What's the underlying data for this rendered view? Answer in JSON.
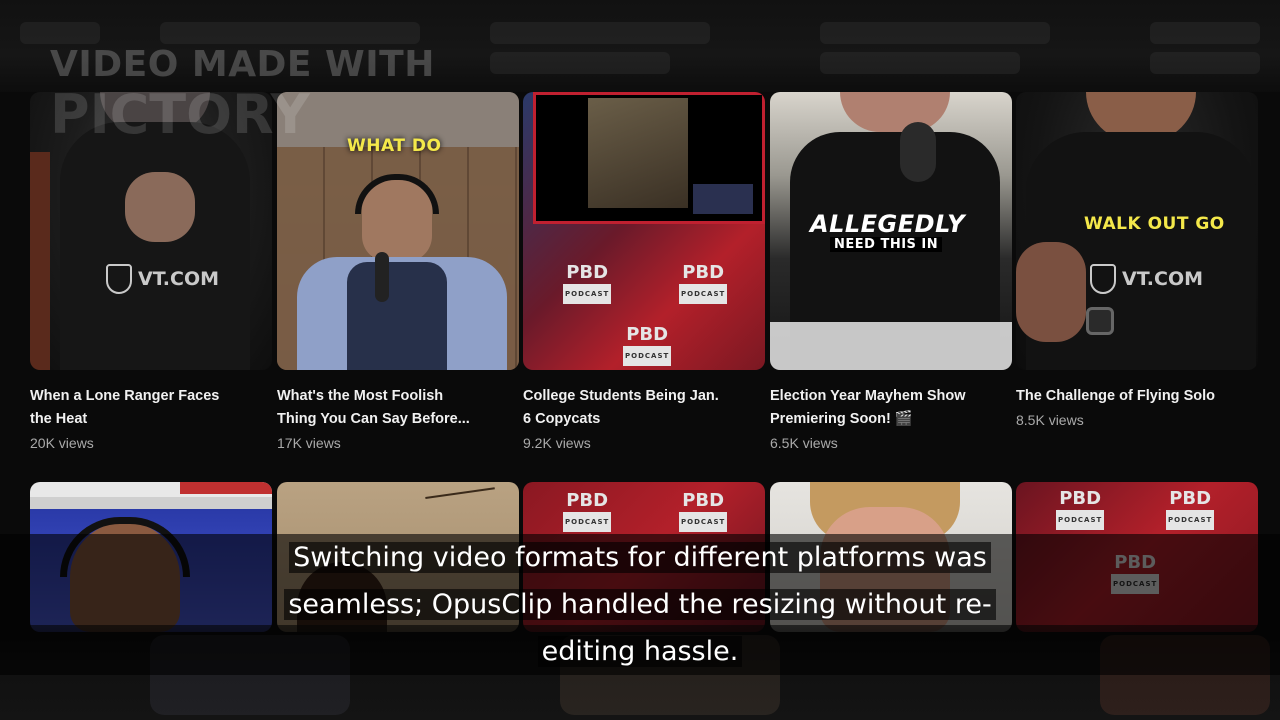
{
  "watermark": {
    "line1": "VIDEO MADE WITH",
    "line2": "PICTORY"
  },
  "videos_row1": [
    {
      "title_line1": "When a Lone Ranger Faces",
      "title_line2": "the Heat",
      "views": "20K views",
      "overlay": "VT.COM"
    },
    {
      "title_line1": "What's the Most Foolish",
      "title_line2": "Thing You Can Say Before...",
      "views": "17K views",
      "overlay": "WHAT DO"
    },
    {
      "title_line1": "College Students Being Jan.",
      "title_line2": "6 Copycats",
      "views": "9.2K views",
      "overlay": "PBD"
    },
    {
      "title_line1": "Election Year Mayhem Show",
      "title_line2": "Premiering Soon! 🎬",
      "views": "6.5K views",
      "overlay": "ALLEGEDLY",
      "overlay2": "NEED THIS IN"
    },
    {
      "title_line1": "The Challenge of Flying Solo",
      "title_line2": "",
      "views": "8.5K views",
      "overlay": "WALK OUT GO",
      "overlay_logo": "VT.COM"
    }
  ],
  "pbd_label": "PBD",
  "pbd_sub": "PODCAST",
  "subtitle": {
    "line1": "Switching video formats for different platforms was",
    "line2": "seamless; OpusClip handled the resizing without re-",
    "line3": "editing hassle."
  },
  "colors": {
    "bg": "#0a0a0a",
    "title": "#f1f1f1",
    "views": "#aaaaaa",
    "caption_yellow": "#f4e84a",
    "pbd_red": "#b3202a"
  }
}
